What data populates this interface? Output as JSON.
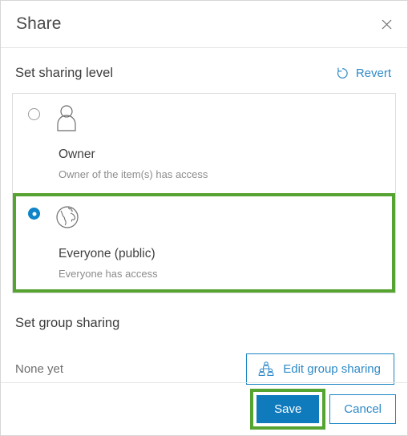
{
  "dialog": {
    "title": "Share",
    "close_icon": "close-icon"
  },
  "sharing_level": {
    "heading": "Set sharing level",
    "revert": {
      "label": "Revert",
      "icon": "revert-arrow-icon"
    },
    "options": [
      {
        "id": "owner",
        "label": "Owner",
        "description": "Owner of the item(s) has access",
        "icon": "person-icon",
        "selected": false,
        "highlighted": false
      },
      {
        "id": "everyone",
        "label": "Everyone (public)",
        "description": "Everyone has access",
        "icon": "globe-icon",
        "selected": true,
        "highlighted": true
      }
    ]
  },
  "group_sharing": {
    "heading": "Set group sharing",
    "status": "None yet",
    "edit_button": {
      "label": "Edit group sharing",
      "icon": "group-people-icon"
    }
  },
  "footer": {
    "save_label": "Save",
    "cancel_label": "Cancel"
  },
  "colors": {
    "accent_blue": "#0f7bbd",
    "link_blue": "#2e8ac8",
    "highlight_green": "#55a330",
    "text_dark": "#3c3c3c",
    "text_muted": "#8c8c8c",
    "border_gray": "#dedede"
  }
}
